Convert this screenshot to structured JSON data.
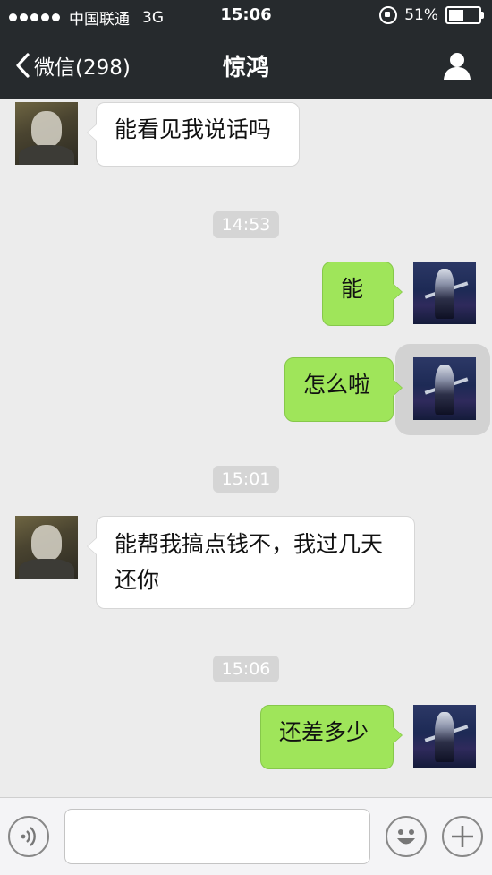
{
  "status_bar": {
    "carrier": "中国联通",
    "network": "3G",
    "time": "15:06",
    "battery_percent": "51%",
    "battery_level": 0.51
  },
  "nav": {
    "back_label": "微信(298)",
    "title": "惊鸿"
  },
  "messages": [
    {
      "side": "in",
      "text": "能看见我说话吗"
    },
    {
      "timestamp": "14:53"
    },
    {
      "side": "out",
      "text": "能"
    },
    {
      "side": "out",
      "text": "怎么啦"
    },
    {
      "timestamp": "15:01"
    },
    {
      "side": "in",
      "text": "能帮我搞点钱不，我过几天还你"
    },
    {
      "timestamp": "15:06"
    },
    {
      "side": "out",
      "text": "还差多少"
    }
  ],
  "colors": {
    "outgoing_bubble": "#9fe55a",
    "bar": "#262a2d",
    "chat_bg": "#ececec"
  },
  "icons": [
    "chevron-left-icon",
    "person-icon",
    "voice-icon",
    "emoji-icon",
    "plus-icon"
  ]
}
